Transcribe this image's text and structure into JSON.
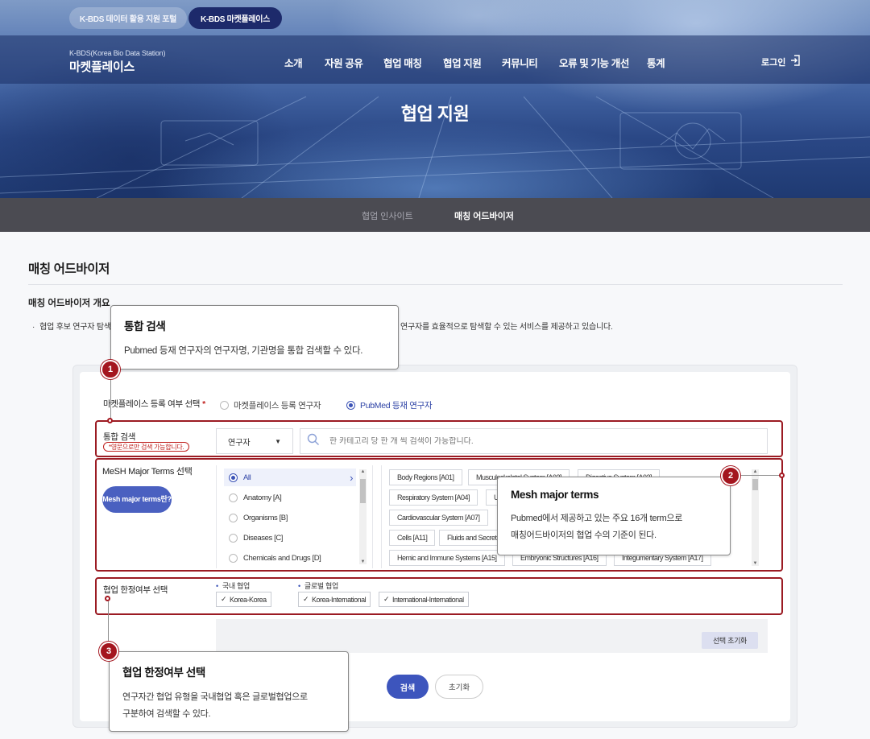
{
  "portal_tabs": [
    "K-BDS 데이터 활용 지원 포털",
    "K-BDS 마켓플레이스"
  ],
  "brand": {
    "sub": "K-BDS(Korea Bio Data Station)",
    "main": "마켓플레이스"
  },
  "gnb": [
    "소개",
    "자원 공유",
    "협업 매칭",
    "협업 지원",
    "커뮤니티",
    "오류 및 기능 개선",
    "통계"
  ],
  "login_label": "로그인",
  "hero_title": "협업 지원",
  "sub_tabs": [
    "협업 인사이트",
    "매칭 어드바이저"
  ],
  "page_title": "매칭 어드바이저",
  "section": {
    "title": "매칭 어드바이저 개요",
    "desc_left": "협업 후보 연구자 탐색",
    "desc_right": "연구자를 효율적으로 탐색할 수 있는 서비스를 제공하고 있습니다."
  },
  "form": {
    "registration_label": "마켓플레이스 등록 여부 선택",
    "radio_options": [
      "마켓플레이스 등록 연구자",
      "PubMed 등재 연구자"
    ],
    "selected_radio": "PubMed 등재 연구자",
    "search_label": "통합 검색",
    "search_note": "*영문으로만 검색 가능합니다.",
    "search_select": "연구자",
    "search_placeholder": "한 카테고리 당 한 개 씩 검색이 가능합니다.",
    "mesh_label": "MeSH Major Terms 선택",
    "mesh_button": "Mesh major terms란?",
    "categories": [
      "All",
      "Anatomy [A]",
      "Organisms [B]",
      "Diseases [C]",
      "Chemicals and Drugs [D]"
    ],
    "terms": [
      "Body Regions [A01]",
      "Musculoskeletal System [A02]",
      "Digestive System [A03]",
      "Respiratory System [A04]",
      "U",
      "Cardiovascular System [A07]",
      "Cells [A11]",
      "Fluids and Secretions",
      "Hemic and Immune Systems [A15]",
      "Embryonic Structures [A16]",
      "Integumentary System [A17]"
    ],
    "limit_label": "협업 한정여부 선택",
    "limit_domestic": "국내 협업",
    "limit_global": "글로벌 협업",
    "limit_options": [
      "Korea-Korea",
      "Korea-International",
      "International-International"
    ],
    "reset_selection": "선택 초기화",
    "search_button": "검색",
    "reset_button": "초기화"
  },
  "callouts": [
    {
      "num": "1",
      "title": "통합 검색",
      "body": "Pubmed 등재 연구자의 연구자명, 기관명을 통합 검색할 수 있다."
    },
    {
      "num": "2",
      "title": "Mesh major terms",
      "body1": "Pubmed에서 제공하고 있는 주요 16개 term으로",
      "body2": "매칭어드바이저의 협업 수의 기준이 된다."
    },
    {
      "num": "3",
      "title": "협업 한정여부 선택",
      "body1": "연구자간 협업 유형을 국내협업 혹은 글로벌협업으로",
      "body2": "구분하여 검색할 수 있다."
    }
  ],
  "colors": {
    "accent": "#3a52b6",
    "highlight": "#9b1b23",
    "tabbar": "#4b4b52"
  }
}
